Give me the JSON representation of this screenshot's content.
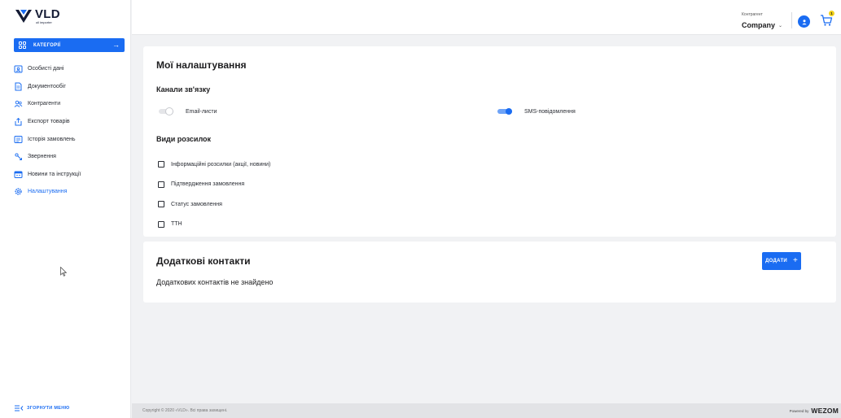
{
  "logo": {
    "name": "VLD",
    "sub": "oil importer"
  },
  "sidebar": {
    "categories_label": "КАТЕГОРІЇ",
    "items": [
      {
        "label": "Особисті дані",
        "icon": "profile-icon",
        "active": false
      },
      {
        "label": "Документообіг",
        "icon": "document-icon",
        "active": false
      },
      {
        "label": "Контрагенти",
        "icon": "users-icon",
        "active": false
      },
      {
        "label": "Експорт товарів",
        "icon": "export-icon",
        "active": false
      },
      {
        "label": "Історія замовлень",
        "icon": "history-icon",
        "active": false
      },
      {
        "label": "Звернення",
        "icon": "appeal-icon",
        "active": false
      },
      {
        "label": "Новини та інструкції",
        "icon": "news-icon",
        "active": false
      },
      {
        "label": "Налаштування",
        "icon": "gear-icon",
        "active": true
      }
    ],
    "collapse_label": "ЗГОРНУТИ МЕНЮ"
  },
  "header": {
    "counterparty_label": "Контрагент",
    "counterparty_value": "Company",
    "cart_count": "1"
  },
  "settings": {
    "title": "Мої налаштування",
    "channels_title": "Канали зв'язку",
    "email_label": "Email-листи",
    "email_on": false,
    "sms_label": "SMS-повідомлення",
    "sms_on": true,
    "types_title": "Види розсилок",
    "types": [
      "Інформаційні розсилки (акції, новини)",
      "Підтвердження замовлення",
      "Статус замовлення",
      "ТТН"
    ]
  },
  "contacts": {
    "title": "Додаткові контакти",
    "add_label": "ДОДАТИ",
    "empty_text": "Додаткових контактів не знайдено"
  },
  "footer": {
    "copyright": "Copyright © 2020 «VLD». Всі права захищені.",
    "powered_label": "Powered by",
    "powered_brand": "WEZOM"
  },
  "colors": {
    "accent": "#1a6cf2",
    "badge": "#f2d21a"
  }
}
